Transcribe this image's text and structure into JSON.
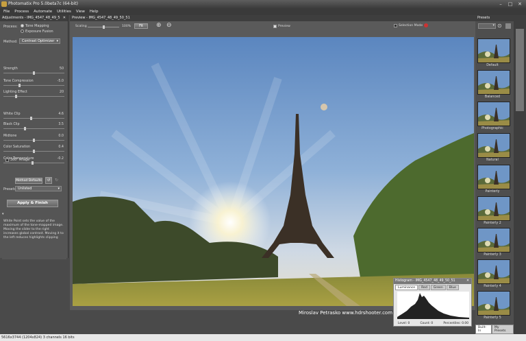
{
  "window": {
    "title": "Photomatix Pro 5.0beta7c (64-bit)",
    "minimize": "–",
    "maximize": "□",
    "close": "✕"
  },
  "menu": [
    "File",
    "Process",
    "Automate",
    "Utilities",
    "View",
    "Help"
  ],
  "adjustments": {
    "header": "Adjustments - IMG_4547_48_49_5",
    "close": "✕",
    "process_label": "Process:",
    "process_options": [
      "Tone Mapping",
      "Exposure Fusion"
    ],
    "process_selected": 0,
    "method_label": "Method:",
    "method_value": "Contrast Optimizer",
    "sliders": [
      {
        "label": "Strength",
        "value": "50",
        "pos": 0.5
      },
      {
        "label": "Tone Compression",
        "value": "-5.0",
        "pos": 0.25
      },
      {
        "label": "Lighting Effect",
        "value": "20",
        "pos": 0.2
      },
      {
        "label": "White Clip",
        "value": "4.6",
        "pos": 0.45
      },
      {
        "label": "Black Clip",
        "value": "3.5",
        "pos": 0.35
      },
      {
        "label": "Midtone",
        "value": "0.0",
        "pos": 0.5
      },
      {
        "label": "Color Saturation",
        "value": "0.4",
        "pos": 0.5
      },
      {
        "label": "Color Temperature",
        "value": "-0.2",
        "pos": 0.48
      }
    ],
    "checkbox_360": "360° image",
    "method_defaults": "Method Defaults",
    "presets_label": "Presets:",
    "presets_value": "Unlisted",
    "apply_button": "Apply & Finish",
    "info_text": "White Point sets the value of the maximum of the tone-mapped image. Moving the slider to the right increases global contrast. Moving it to the left reduces highlights clipping"
  },
  "preview": {
    "header": "Preview - IMG_4547_48_49_50_51",
    "scaling_label": "Scaling",
    "scaling_value": "100%",
    "fit_button": "Fit",
    "preview_checkbox": "Preview",
    "selection_mode": "Selection Mode",
    "watermark": "Miroslav Petrasko  www.hdrshooter.com"
  },
  "presets_panel": {
    "header": "Presets",
    "items": [
      "Default",
      "Balanced",
      "Photographic",
      "Natural",
      "Painterly",
      "Painterly 2",
      "Painterly 3",
      "Painterly 4",
      "Painterly 5"
    ],
    "tab_builtin": "Built-In",
    "tab_my": "My Presets"
  },
  "histogram": {
    "header": "Histogram - IMG_4547_48_49_50_51",
    "tabs": [
      "Luminance",
      "Red",
      "Green",
      "Blue"
    ],
    "level": "Level: 0",
    "count": "Count: 0",
    "percentiles": "Percentiles: 0.00"
  },
  "status_bar": "5616x3744 (1204x824) 3 channels 16 bits"
}
